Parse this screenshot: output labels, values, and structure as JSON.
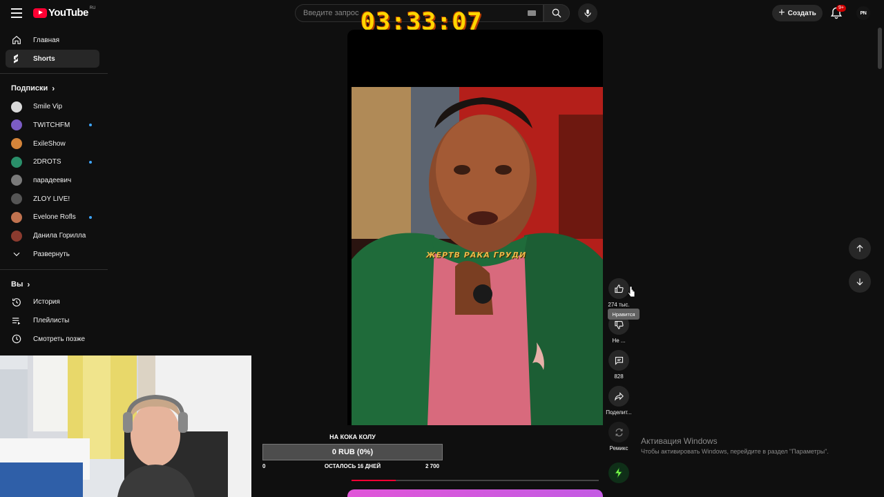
{
  "header": {
    "logo_text": "YouTube",
    "logo_region": "RU",
    "search_placeholder": "Введите запрос",
    "create_label": "Создать",
    "notifications_badge": "9+",
    "account_initials": "PN"
  },
  "overlay_timer": "03:33:07",
  "sidebar": {
    "main_items": [
      {
        "label": "Главная",
        "icon": "home-icon"
      },
      {
        "label": "Shorts",
        "icon": "shorts-icon",
        "active": true
      }
    ],
    "subscriptions_heading": "Подписки",
    "subscriptions": [
      {
        "label": "Smile Vip",
        "live": false,
        "color": "#d9d9d9"
      },
      {
        "label": "TWITCHFM",
        "live": true,
        "color": "#7b5cc4"
      },
      {
        "label": "ExileShow",
        "live": false,
        "color": "#d4843a"
      },
      {
        "label": "2DROTS",
        "live": true,
        "color": "#2a8f6a"
      },
      {
        "label": "парадеевич",
        "live": false,
        "color": "#7a7a7a"
      },
      {
        "label": "ZLOY LIVE!",
        "live": false,
        "color": "#555555"
      },
      {
        "label": "Evelone Rofls",
        "live": true,
        "color": "#c0724f"
      },
      {
        "label": "Данила Горилла",
        "live": false,
        "color": "#8b3b2f"
      }
    ],
    "expand_label": "Развернуть",
    "you_heading": "Вы",
    "you_items": [
      {
        "label": "История",
        "icon": "history-icon"
      },
      {
        "label": "Плейлисты",
        "icon": "playlists-icon"
      },
      {
        "label": "Смотреть позже",
        "icon": "watch-later-icon"
      }
    ]
  },
  "short": {
    "caption": "ЖЕРТВ РАКА ГРУДИ",
    "progress_fraction": 0.18
  },
  "actions": {
    "like_count": "274 тыс.",
    "like_tooltip": "Нравится",
    "dislike_label": "Не ...",
    "comments_count": "828",
    "share_label": "Поделит...",
    "remix_label": "Ремикс"
  },
  "donation": {
    "title": "НА КОКА КОЛУ",
    "amount": "0 RUB (0%)",
    "min": "0",
    "remaining": "ОСТАЛОСЬ 16 ДНЕЙ",
    "goal": "2 700"
  },
  "windows_watermark": {
    "title": "Активация Windows",
    "subtitle": "Чтобы активировать Windows, перейдите в раздел \"Параметры\"."
  },
  "colors": {
    "background": "#0f0f0f",
    "accent_red": "#ff0033",
    "timer_yellow": "#ffd600",
    "chip": "#272727"
  }
}
